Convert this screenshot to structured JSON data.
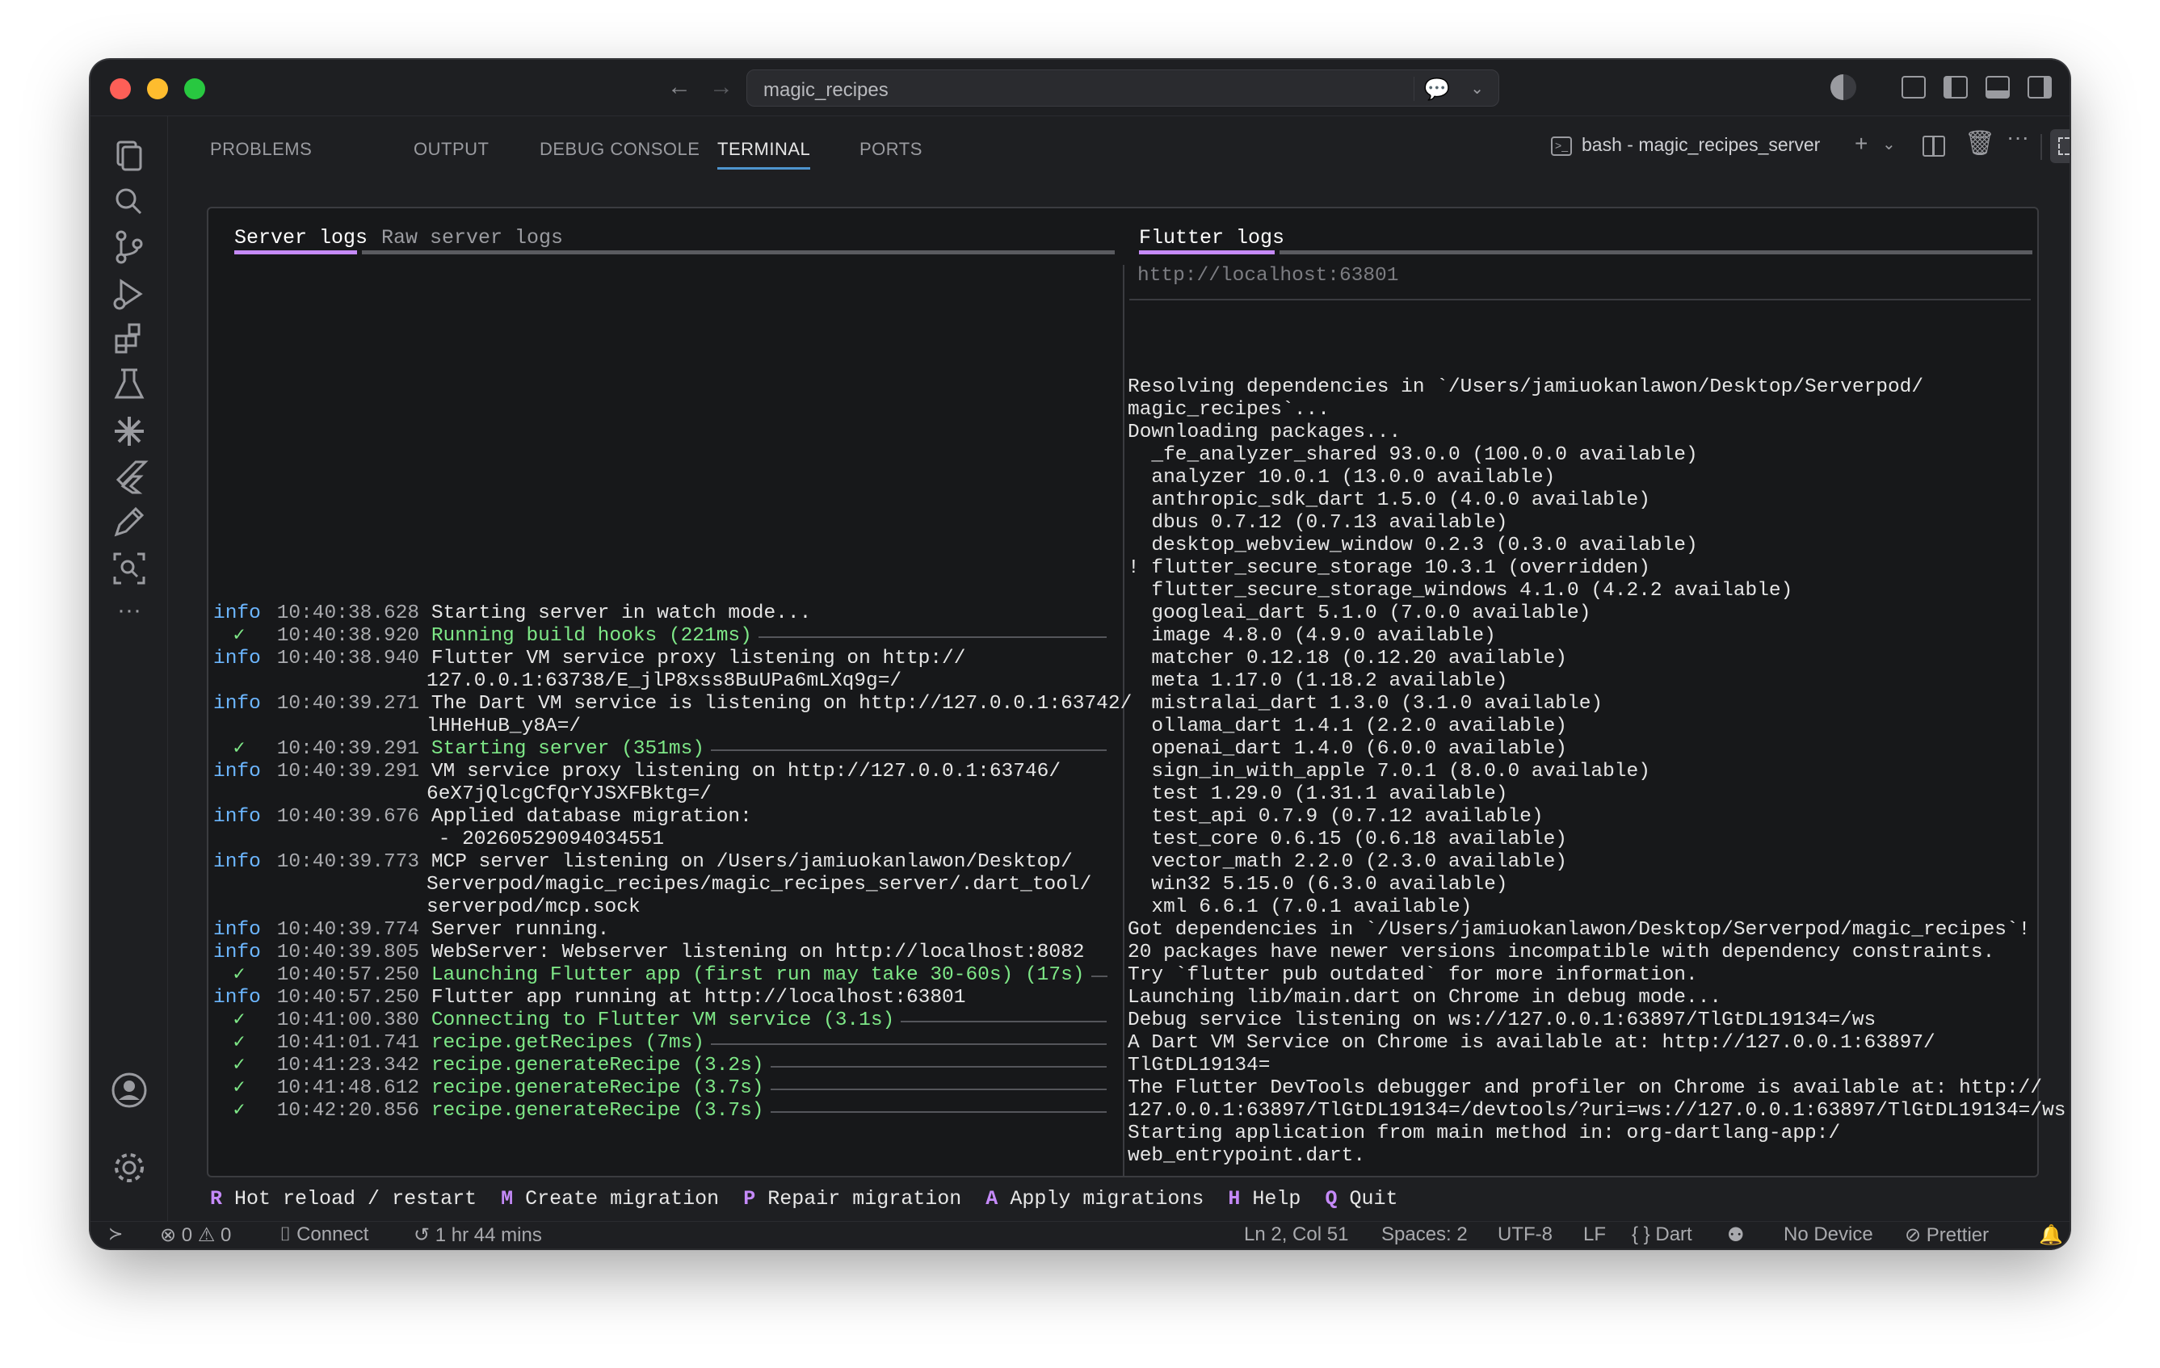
{
  "search": {
    "text": "magic_recipes"
  },
  "panel": {
    "tabs": [
      {
        "label": "PROBLEMS"
      },
      {
        "label": "OUTPUT"
      },
      {
        "label": "DEBUG CONSOLE"
      },
      {
        "label": "TERMINAL"
      },
      {
        "label": "PORTS"
      }
    ],
    "terminal_name": "bash - magic_recipes_server"
  },
  "subtabs": {
    "server_logs": "Server logs",
    "raw_server_logs": "Raw server logs",
    "flutter_logs": "Flutter logs"
  },
  "server_log": [
    {
      "level": "info",
      "time": "10:40:38.628",
      "msg": "Starting server in watch mode...",
      "ok": false,
      "cont": []
    },
    {
      "level": "✓",
      "time": "10:40:38.920",
      "msg": "Running build hooks (221ms)",
      "ok": true,
      "cont": []
    },
    {
      "level": "info",
      "time": "10:40:38.940",
      "msg": "Flutter VM service proxy listening on http://",
      "ok": false,
      "cont": [
        "127.0.0.1:63738/E_jlP8xss8BuUPa6mLXq9g=/"
      ]
    },
    {
      "level": "info",
      "time": "10:40:39.271",
      "msg": "The Dart VM service is listening on http://127.0.0.1:63742/",
      "ok": false,
      "cont": [
        "lHHeHuB_y8A=/"
      ]
    },
    {
      "level": "✓",
      "time": "10:40:39.291",
      "msg": "Starting server (351ms)",
      "ok": true,
      "cont": []
    },
    {
      "level": "info",
      "time": "10:40:39.291",
      "msg": "VM service proxy listening on http://127.0.0.1:63746/",
      "ok": false,
      "cont": [
        "6eX7jQlcgCfQrYJSXFBktg=/"
      ]
    },
    {
      "level": "info",
      "time": "10:40:39.676",
      "msg": "Applied database migration:",
      "ok": false,
      "cont": [
        " - 20260529094034551"
      ]
    },
    {
      "level": "info",
      "time": "10:40:39.773",
      "msg": "MCP server listening on /Users/jamiuokanlawon/Desktop/",
      "ok": false,
      "cont": [
        "Serverpod/magic_recipes/magic_recipes_server/.dart_tool/",
        "serverpod/mcp.sock"
      ]
    },
    {
      "level": "info",
      "time": "10:40:39.774",
      "msg": "Server running.",
      "ok": false,
      "cont": []
    },
    {
      "level": "info",
      "time": "10:40:39.805",
      "msg": "WebServer: Webserver listening on http://localhost:8082",
      "ok": false,
      "cont": []
    },
    {
      "level": "✓",
      "time": "10:40:57.250",
      "msg": "Launching Flutter app (first run may take 30-60s) (17s)",
      "ok": true,
      "cont": []
    },
    {
      "level": "info",
      "time": "10:40:57.250",
      "msg": "Flutter app running at http://localhost:63801",
      "ok": false,
      "cont": []
    },
    {
      "level": "✓",
      "time": "10:41:00.380",
      "msg": "Connecting to Flutter VM service (3.1s)",
      "ok": true,
      "cont": []
    },
    {
      "level": "✓",
      "time": "10:41:01.741",
      "msg": "recipe.getRecipes (7ms)",
      "ok": true,
      "cont": []
    },
    {
      "level": "✓",
      "time": "10:41:23.342",
      "msg": "recipe.generateRecipe (3.2s)",
      "ok": true,
      "cont": []
    },
    {
      "level": "✓",
      "time": "10:41:48.612",
      "msg": "recipe.generateRecipe (3.7s)",
      "ok": true,
      "cont": []
    },
    {
      "level": "✓",
      "time": "10:42:20.856",
      "msg": "recipe.generateRecipe (3.7s)",
      "ok": true,
      "cont": []
    }
  ],
  "flutter": {
    "url": "http://localhost:63801",
    "lines": [
      "Resolving dependencies in `/Users/jamiuokanlawon/Desktop/Serverpod/",
      "magic_recipes`...",
      "Downloading packages...",
      "  _fe_analyzer_shared 93.0.0 (100.0.0 available)",
      "  analyzer 10.0.1 (13.0.0 available)",
      "  anthropic_sdk_dart 1.5.0 (4.0.0 available)",
      "  dbus 0.7.12 (0.7.13 available)",
      "  desktop_webview_window 0.2.3 (0.3.0 available)",
      "! flutter_secure_storage 10.3.1 (overridden)",
      "  flutter_secure_storage_windows 4.1.0 (4.2.2 available)",
      "  googleai_dart 5.1.0 (7.0.0 available)",
      "  image 4.8.0 (4.9.0 available)",
      "  matcher 0.12.18 (0.12.20 available)",
      "  meta 1.17.0 (1.18.2 available)",
      "  mistralai_dart 1.3.0 (3.1.0 available)",
      "  ollama_dart 1.4.1 (2.2.0 available)",
      "  openai_dart 1.4.0 (6.0.0 available)",
      "  sign_in_with_apple 7.0.1 (8.0.0 available)",
      "  test 1.29.0 (1.31.1 available)",
      "  test_api 0.7.9 (0.7.12 available)",
      "  test_core 0.6.15 (0.6.18 available)",
      "  vector_math 2.2.0 (2.3.0 available)",
      "  win32 5.15.0 (6.3.0 available)",
      "  xml 6.6.1 (7.0.1 available)",
      "Got dependencies in `/Users/jamiuokanlawon/Desktop/Serverpod/magic_recipes`!",
      "20 packages have newer versions incompatible with dependency constraints.",
      "Try `flutter pub outdated` for more information.",
      "Launching lib/main.dart on Chrome in debug mode...",
      "Debug service listening on ws://127.0.0.1:63897/TlGtDL19134=/ws",
      "A Dart VM Service on Chrome is available at: http://127.0.0.1:63897/",
      "TlGtDL19134=",
      "The Flutter DevTools debugger and profiler on Chrome is available at: http://",
      "127.0.0.1:63897/TlGtDL19134=/devtools/?uri=ws://127.0.0.1:63897/TlGtDL19134=/ws",
      "Starting application from main method in: org-dartlang-app:/",
      "web_entrypoint.dart."
    ]
  },
  "hotkeys": [
    {
      "key": "R",
      "label": "Hot reload / restart"
    },
    {
      "key": "M",
      "label": "Create migration"
    },
    {
      "key": "P",
      "label": "Repair migration"
    },
    {
      "key": "A",
      "label": "Apply migrations"
    },
    {
      "key": "H",
      "label": "Help"
    },
    {
      "key": "Q",
      "label": "Quit"
    }
  ],
  "status": {
    "errors": "0",
    "warnings": "0",
    "connect": "Connect",
    "time": "1 hr 44 mins",
    "position": "Ln 2, Col 51",
    "spaces": "Spaces: 2",
    "encoding": "UTF-8",
    "eol": "LF",
    "language": "Dart",
    "device": "No Device",
    "formatter": "Prettier"
  }
}
